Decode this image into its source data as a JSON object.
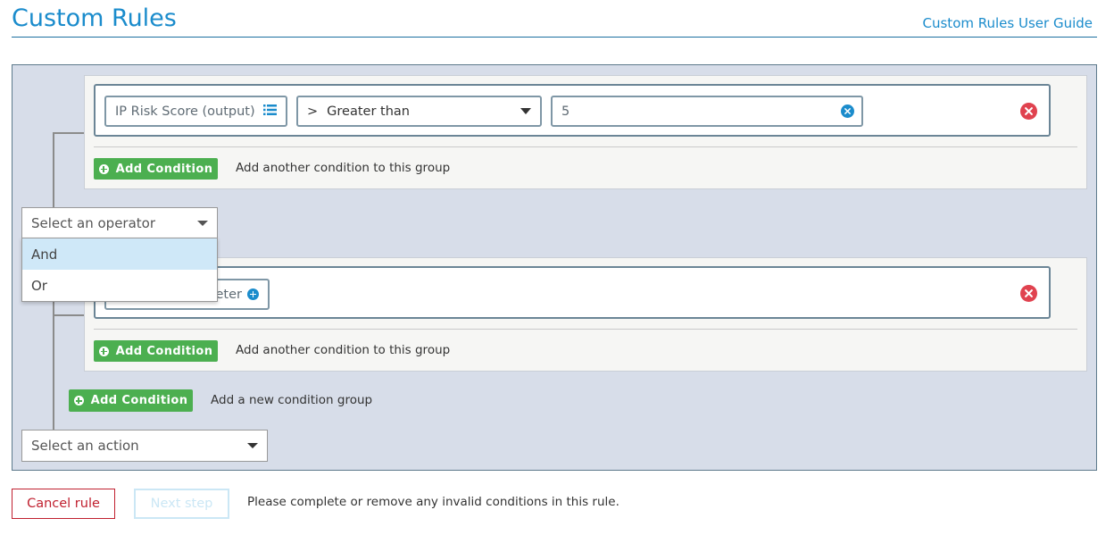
{
  "header": {
    "title": "Custom Rules",
    "guide_link": "Custom Rules User Guide"
  },
  "group1": {
    "condition": {
      "field_label": "IP Risk Score (output)",
      "field_icon": "list-icon",
      "operator_symbol": ">",
      "operator_label": "Greater than",
      "value": "5"
    },
    "add_button": "Add Condition",
    "add_hint": "Add another condition to this group"
  },
  "operator_dropdown": {
    "placeholder": "Select an operator",
    "options": [
      "And",
      "Or"
    ],
    "highlighted": "And"
  },
  "group2": {
    "condition": {
      "field_partial": "eter"
    },
    "add_button": "Add Condition",
    "add_hint": "Add another condition to this group"
  },
  "root": {
    "add_button": "Add Condition",
    "add_hint": "Add a new condition group"
  },
  "action_select": {
    "placeholder": "Select an action"
  },
  "footer": {
    "cancel_label": "Cancel rule",
    "next_label": "Next step",
    "message": "Please complete or remove any invalid conditions in this rule."
  },
  "colors": {
    "accent": "#1b8ccc",
    "add_green": "#4caf50",
    "remove_red": "#e0424f",
    "cancel_red": "#c0202f",
    "panel_bg": "#d7dde9"
  }
}
